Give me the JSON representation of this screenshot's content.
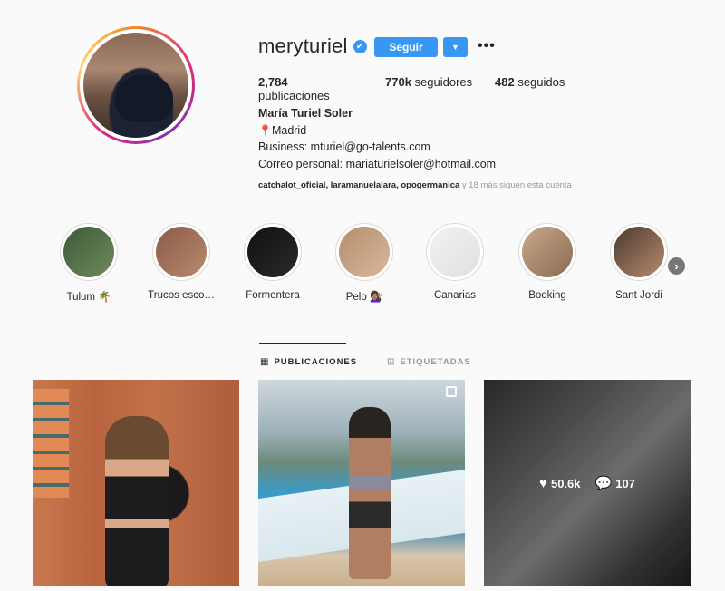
{
  "profile": {
    "username": "meryturiel",
    "verified_glyph": "✔",
    "follow_label": "Seguir",
    "dropdown_glyph": "▼",
    "more_glyph": "•••",
    "stats": {
      "posts_count": "2,784",
      "posts_label": " publicaciones",
      "followers_count": "770k",
      "followers_label": " seguidores",
      "following_count": "482",
      "following_label": " seguidos"
    },
    "bio": {
      "full_name": "María Turiel Soler",
      "location_icon": "📍",
      "location": "Madrid",
      "business": "Business: mturiel@go-talents.com",
      "personal": "Correo personal: mariaturielsoler@hotmail.com"
    },
    "followed_by": {
      "names": "catchalot_oficial, laramanuelalara, opogermanica",
      "more": " y 18 más siguen esta cuenta"
    }
  },
  "highlights": [
    {
      "label": "Tulum 🌴",
      "colors": [
        "#3d5a3a",
        "#6f8b5a"
      ]
    },
    {
      "label": "Trucos esco…",
      "colors": [
        "#8a5a48",
        "#b98a6e"
      ]
    },
    {
      "label": "Formentera",
      "colors": [
        "#111111",
        "#2a2a2a"
      ]
    },
    {
      "label": "Pelo 💇🏽‍♀️",
      "colors": [
        "#b38e6e",
        "#d9b89a"
      ]
    },
    {
      "label": "Canarias",
      "colors": [
        "#f2f2f2",
        "#e0e0e0"
      ]
    },
    {
      "label": "Booking",
      "colors": [
        "#c9a98a",
        "#8a6a52"
      ]
    },
    {
      "label": "Sant Jordi",
      "colors": [
        "#4a3a30",
        "#b98a6e"
      ]
    }
  ],
  "highlights_next_glyph": "›",
  "tabs": {
    "posts_icon": "▦",
    "posts": "PUBLICACIONES",
    "tagged_icon": "⊡",
    "tagged": "ETIQUETADAS"
  },
  "posts": {
    "third_likes": "50.6k",
    "third_comments": "107",
    "heart_glyph": "♥",
    "comment_glyph": "💬"
  },
  "colors": {
    "accent": "#3897f0",
    "background": "#fafafa",
    "text": "#262626",
    "muted": "#999999",
    "border": "#dbdbdb"
  }
}
